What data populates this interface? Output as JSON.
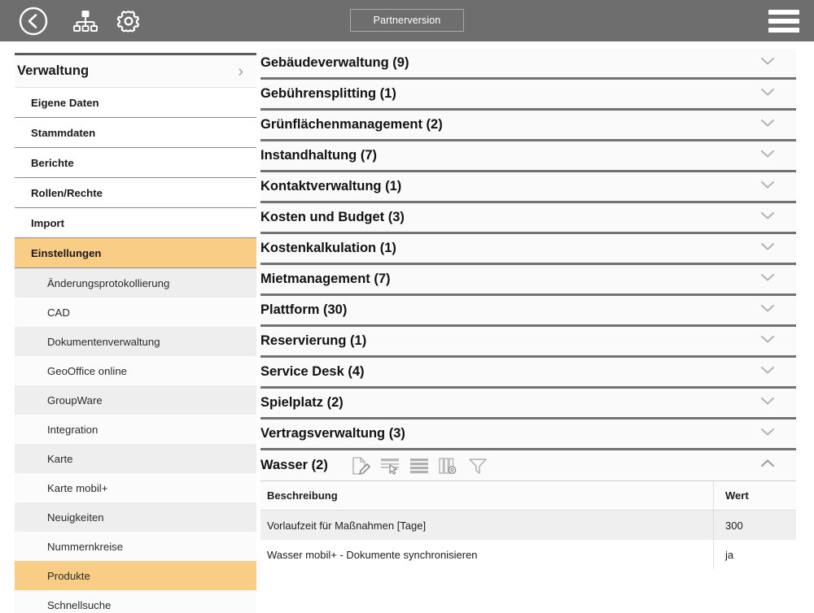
{
  "topbar": {
    "back_icon": "back-circle-arrow-icon",
    "sitemap_icon": "sitemap-icon",
    "gear_icon": "gear-icon",
    "partner_label": "Partnerversion",
    "menu_icon": "hamburger-menu-icon"
  },
  "sidebar": {
    "header": {
      "title": "Verwaltung",
      "chevron": "›"
    },
    "items": [
      {
        "label": "Eigene Daten",
        "type": "item",
        "selected": false
      },
      {
        "label": "Stammdaten",
        "type": "item",
        "selected": false
      },
      {
        "label": "Berichte",
        "type": "item",
        "selected": false
      },
      {
        "label": "Rollen/Rechte",
        "type": "item",
        "selected": false
      },
      {
        "label": "Import",
        "type": "item",
        "selected": false
      },
      {
        "label": "Einstellungen",
        "type": "item",
        "selected": true
      },
      {
        "label": "Änderungsprotokollierung",
        "type": "sub",
        "selected": false
      },
      {
        "label": "CAD",
        "type": "sub",
        "selected": false
      },
      {
        "label": "Dokumentenverwaltung",
        "type": "sub",
        "selected": false
      },
      {
        "label": "GeoOffice online",
        "type": "sub",
        "selected": false
      },
      {
        "label": "GroupWare",
        "type": "sub",
        "selected": false
      },
      {
        "label": "Integration",
        "type": "sub",
        "selected": false
      },
      {
        "label": "Karte",
        "type": "sub",
        "selected": false
      },
      {
        "label": "Karte mobil+",
        "type": "sub",
        "selected": false
      },
      {
        "label": "Neuigkeiten",
        "type": "sub",
        "selected": false
      },
      {
        "label": "Nummernkreise",
        "type": "sub",
        "selected": false
      },
      {
        "label": "Produkte",
        "type": "sub",
        "selected": true
      },
      {
        "label": "Schnellsuche",
        "type": "sub",
        "selected": false
      }
    ]
  },
  "main": {
    "sections": [
      {
        "label": "Gebäudeverwaltung (9)",
        "open": false,
        "caret": "⌄"
      },
      {
        "label": "Gebührensplitting (1)",
        "open": false,
        "caret": "⌄"
      },
      {
        "label": "Grünflächenmanagement (2)",
        "open": false,
        "caret": "⌄"
      },
      {
        "label": "Instandhaltung (7)",
        "open": false,
        "caret": "⌄"
      },
      {
        "label": "Kontaktverwaltung (1)",
        "open": false,
        "caret": "⌄"
      },
      {
        "label": "Kosten und Budget (3)",
        "open": false,
        "caret": "⌄"
      },
      {
        "label": "Kostenkalkulation (1)",
        "open": false,
        "caret": "⌄"
      },
      {
        "label": "Mietmanagement (7)",
        "open": false,
        "caret": "⌄"
      },
      {
        "label": "Plattform (30)",
        "open": false,
        "caret": "⌄"
      },
      {
        "label": "Reservierung (1)",
        "open": false,
        "caret": "⌄"
      },
      {
        "label": "Service Desk (4)",
        "open": false,
        "caret": "⌄"
      },
      {
        "label": "Spielplatz (2)",
        "open": false,
        "caret": "⌄"
      },
      {
        "label": "Vertragsverwaltung (3)",
        "open": false,
        "caret": "⌄"
      },
      {
        "label": "Wasser (2)",
        "open": true,
        "caret": "⌃"
      }
    ],
    "toolbar_icons": [
      "edit-document-icon",
      "select-row-icon",
      "table-rows-icon",
      "column-settings-icon",
      "filter-funnel-icon"
    ],
    "table": {
      "columns": [
        "Beschreibung",
        "Wert"
      ],
      "rows": [
        {
          "beschreibung": "Vorlaufzeit für Maßnahmen [Tage]",
          "wert": "300"
        },
        {
          "beschreibung": "Wasser mobil+ - Dokumente synchronisieren",
          "wert": "ja"
        }
      ]
    }
  },
  "colors": {
    "topbar": "#6e6e6e",
    "highlight": "#f9cd85",
    "divider": "#737373",
    "row_alt": "#efefef"
  }
}
